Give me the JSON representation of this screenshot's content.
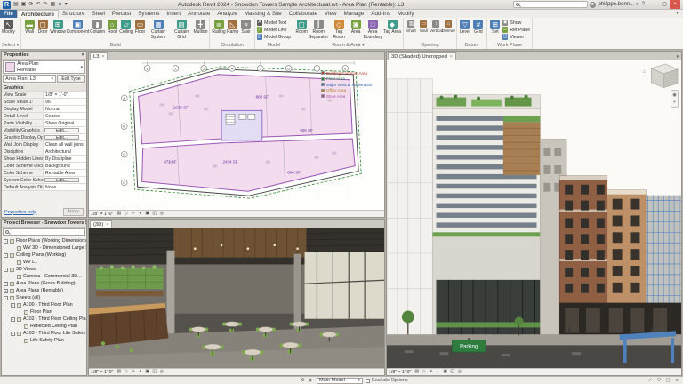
{
  "ui": {
    "close": "×",
    "min": "–",
    "max": "▢",
    "caret": "▾"
  },
  "titlebar": {
    "title": "Autodesk Revit 2024 - Snowdon Towers Sample Architectural.rvt - Area Plan (Rentable): L3",
    "user": "philippe.bonn...",
    "qat": [
      {
        "g": "▤",
        "n": "open-icon"
      },
      {
        "g": "▣",
        "n": "save-icon"
      },
      {
        "g": "⟳",
        "n": "sync-icon"
      },
      {
        "g": "↶",
        "n": "undo-icon"
      },
      {
        "g": "↷",
        "n": "redo-icon"
      },
      {
        "g": "▦",
        "n": "print-icon"
      },
      {
        "g": "◈",
        "n": "measure-icon"
      },
      {
        "g": "▾",
        "n": "customize-qat-icon"
      }
    ]
  },
  "ribbon": {
    "tabs": [
      {
        "label": "File",
        "cls": "file"
      },
      {
        "label": "Architecture",
        "cls": "active"
      },
      {
        "label": "Structure",
        "cls": ""
      },
      {
        "label": "Steel",
        "cls": ""
      },
      {
        "label": "Precast",
        "cls": ""
      },
      {
        "label": "Systems",
        "cls": ""
      },
      {
        "label": "Insert",
        "cls": ""
      },
      {
        "label": "Annotate",
        "cls": ""
      },
      {
        "label": "Analyze",
        "cls": ""
      },
      {
        "label": "Massing & Site",
        "cls": ""
      },
      {
        "label": "Collaborate",
        "cls": ""
      },
      {
        "label": "View",
        "cls": ""
      },
      {
        "label": "Manage",
        "cls": ""
      },
      {
        "label": "Add-Ins",
        "cls": ""
      },
      {
        "label": "Modify",
        "cls": ""
      }
    ],
    "panels": [
      {
        "label": "Select ▾",
        "buttons": [
          {
            "label": "Modify",
            "g": "↖",
            "tone": "dark",
            "name": "modify-button"
          }
        ]
      },
      {
        "label": "Build",
        "buttons": [
          {
            "label": "Wall",
            "g": "▬",
            "tone": "green",
            "name": "wall-button"
          },
          {
            "label": "Door",
            "g": "▢",
            "tone": "brown",
            "name": "door-button"
          },
          {
            "label": "Window",
            "g": "⊞",
            "tone": "teal",
            "name": "window-button"
          },
          {
            "label": "Component",
            "g": "▣",
            "tone": "blue",
            "name": "component-button"
          },
          {
            "label": "Column",
            "g": "▮",
            "tone": "gray",
            "name": "column-button"
          },
          {
            "label": "Roof",
            "g": "⌂",
            "tone": "green",
            "name": "roof-button"
          },
          {
            "label": "Ceiling",
            "g": "▱",
            "tone": "teal",
            "name": "ceiling-button"
          },
          {
            "label": "Floor",
            "g": "▭",
            "tone": "brown",
            "name": "floor-button"
          },
          {
            "label": "Curtain System",
            "g": "▦",
            "tone": "blue",
            "name": "curtain-system-button"
          },
          {
            "label": "Curtain Grid",
            "g": "▤",
            "tone": "teal",
            "name": "curtain-grid-button"
          },
          {
            "label": "Mullion",
            "g": "╋",
            "tone": "gray",
            "name": "mullion-button"
          }
        ]
      },
      {
        "label": "Circulation",
        "buttons": [
          {
            "label": "Railing",
            "g": "≣",
            "tone": "green",
            "name": "railing-button"
          },
          {
            "label": "Ramp",
            "g": "◺",
            "tone": "brown",
            "name": "ramp-button"
          },
          {
            "label": "Stair",
            "g": "≡",
            "tone": "gray",
            "name": "stair-button"
          }
        ]
      },
      {
        "label": "Model",
        "buttons": [
          {
            "label": "Model Text",
            "g": "A",
            "tone": "dark",
            "name": "model-text-button"
          },
          {
            "label": "Model Line",
            "g": "╱",
            "tone": "green",
            "name": "model-line-button"
          },
          {
            "label": "Model Group",
            "g": "◫",
            "tone": "blue",
            "name": "model-group-button"
          }
        ]
      },
      {
        "label": "Room & Area ▾",
        "buttons": [
          {
            "label": "Room",
            "g": "▢",
            "tone": "teal",
            "name": "room-button"
          },
          {
            "label": "Room Separator",
            "g": "┃",
            "tone": "gray",
            "name": "room-separator-button"
          },
          {
            "label": "Tag Room",
            "g": "◇",
            "tone": "orange",
            "name": "tag-room-button"
          },
          {
            "label": "Area",
            "g": "▣",
            "tone": "green",
            "name": "area-button"
          },
          {
            "label": "Area Boundary",
            "g": "□",
            "tone": "purple",
            "name": "area-boundary-button"
          },
          {
            "label": "Tag Area",
            "g": "◆",
            "tone": "teal",
            "name": "tag-area-button"
          }
        ]
      },
      {
        "label": "Opening",
        "buttons": [
          {
            "label": "Shaft",
            "g": "▥",
            "tone": "gray",
            "name": "shaft-opening-button"
          },
          {
            "label": "Wall",
            "g": "▭",
            "tone": "brown",
            "name": "wall-opening-button"
          },
          {
            "label": "Vertical",
            "g": "↕",
            "tone": "gray",
            "name": "vertical-opening-button"
          },
          {
            "label": "Dormer",
            "g": "⌂",
            "tone": "brown",
            "name": "dormer-opening-button"
          }
        ]
      },
      {
        "label": "Datum",
        "buttons": [
          {
            "label": "Level",
            "g": "▽",
            "tone": "blue",
            "name": "level-button"
          },
          {
            "label": "Grid",
            "g": "#",
            "tone": "blue",
            "name": "grid-button"
          }
        ]
      },
      {
        "label": "Work Plane",
        "large": [
          {
            "label": "Set",
            "g": "⊞",
            "tone": "blue",
            "name": "set-work-plane-button"
          }
        ],
        "stack": [
          {
            "label": "Show",
            "g": "◉",
            "tone": "gray",
            "name": "show-work-plane-button"
          },
          {
            "label": "Ref Plane",
            "g": "▱",
            "tone": "green",
            "name": "ref-plane-button"
          },
          {
            "label": "Viewer",
            "g": "◫",
            "tone": "blue",
            "name": "viewer-button"
          }
        ]
      }
    ]
  },
  "properties": {
    "header": "Properties",
    "type_line1": "Area Plan",
    "type_line2": "Rentable",
    "instance_label": "Area Plan: L3",
    "edit_type": "Edit Type",
    "help": "Properties help",
    "apply": "Apply",
    "rows": [
      {
        "kind": "section",
        "label": "Graphics",
        "value": ""
      },
      {
        "kind": "row",
        "label": "View Scale",
        "value": "1/8\" = 1'-0\""
      },
      {
        "kind": "row",
        "label": "Scale Value    1:",
        "value": "96"
      },
      {
        "kind": "row",
        "label": "Display Model",
        "value": "Normal"
      },
      {
        "kind": "row",
        "label": "Detail Level",
        "value": "Coarse"
      },
      {
        "kind": "row",
        "label": "Parts Visibility",
        "value": "Show Original"
      },
      {
        "kind": "button",
        "label": "Visibility/Graphics ...",
        "value": "Edit..."
      },
      {
        "kind": "button",
        "label": "Graphic Display Opti...",
        "value": "Edit..."
      },
      {
        "kind": "row",
        "label": "Wall Join Display",
        "value": "Clean all wall joins"
      },
      {
        "kind": "row",
        "label": "Discipline",
        "value": "Architectural"
      },
      {
        "kind": "row",
        "label": "Show Hidden Lines",
        "value": "By Discipline"
      },
      {
        "kind": "row",
        "label": "Color Scheme Locati...",
        "value": "Background"
      },
      {
        "kind": "row",
        "label": "Color Scheme",
        "value": "Rentable Area"
      },
      {
        "kind": "button",
        "label": "System Color Schem...",
        "value": "Edit..."
      },
      {
        "kind": "row",
        "label": "Default Analysis Dis...",
        "value": "None"
      }
    ]
  },
  "browser": {
    "title": "Project Browser - Snowdon Towers Sample A...",
    "items": [
      {
        "label": "Floor Plans (Working Dimensions)",
        "depth": 0,
        "exp": "-"
      },
      {
        "label": "WV 3D - Dimensioned Large Scale",
        "depth": 1,
        "exp": ""
      },
      {
        "label": "Ceiling Plans (Working)",
        "depth": 0,
        "exp": "-"
      },
      {
        "label": "WV L1",
        "depth": 1,
        "exp": ""
      },
      {
        "label": "3D Views",
        "depth": 0,
        "exp": "-"
      },
      {
        "label": "Camera - Commercial 3D...",
        "depth": 1,
        "exp": ""
      },
      {
        "label": "Area Plans (Gross Building)",
        "depth": 0,
        "exp": "+"
      },
      {
        "label": "Area Plans (Rentable)",
        "depth": 0,
        "exp": "+"
      },
      {
        "label": "Sheets (all)",
        "depth": 0,
        "exp": "-"
      },
      {
        "label": "A100 - Third Floor Plan",
        "depth": 1,
        "exp": "-"
      },
      {
        "label": "Floor Plan",
        "depth": 2,
        "exp": ""
      },
      {
        "label": "A102 - Third Floor Ceiling Plan",
        "depth": 1,
        "exp": "-"
      },
      {
        "label": "Reflected Ceiling Plan",
        "depth": 2,
        "exp": ""
      },
      {
        "label": "A103 - Third Floor Life Safety Plan",
        "depth": 1,
        "exp": "-"
      },
      {
        "label": "Life Safety Plan",
        "depth": 2,
        "exp": ""
      }
    ]
  },
  "planview": {
    "tab": "L3",
    "scale": "1/8\" = 1'-0\"",
    "grids": [
      "1",
      "2",
      "3",
      "4",
      "5",
      "6",
      "7",
      "8"
    ],
    "letters": [
      "A",
      "B",
      "C",
      "D"
    ],
    "tags": [
      "1035 SF",
      "888 SF",
      "2434 SF",
      "926 SF",
      "871 SF",
      "864 SF"
    ],
    "legend": [
      {
        "label": "Building Common Area",
        "style": "color:#c0392b",
        "chip": "background:#c0392b"
      },
      {
        "label": "Floor Area",
        "style": "color:#27863b",
        "chip": "background:#27863b"
      },
      {
        "label": "Major Vertical Penetration",
        "style": "color:#2e5fb0",
        "chip": "background:#2e5fb0"
      },
      {
        "label": "Office Area",
        "style": "color:#b07d2a",
        "chip": "background:#b07d2a"
      },
      {
        "label": "Store Area",
        "style": "color:#a04f9e",
        "chip": "background:#a04f9e"
      }
    ]
  },
  "interior": {
    "tab": "(3D)",
    "scale": "1/8\" = 1'-0\""
  },
  "exterior": {
    "tab": "3D (Shaded) Uncropped",
    "scale": "1/8\" = 1'-0\"",
    "parking": "Parking"
  },
  "viewbar": {
    "icons": [
      {
        "g": "▤",
        "n": "detail-level-icon"
      },
      {
        "g": "◇",
        "n": "visual-style-icon"
      },
      {
        "g": "☀",
        "n": "sun-path-icon"
      },
      {
        "g": "◐",
        "n": "shadows-icon"
      },
      {
        "g": "▣",
        "n": "crop-view-icon"
      },
      {
        "g": "◱",
        "n": "show-crop-icon"
      },
      {
        "g": "◎",
        "n": "reveal-hidden-icon"
      }
    ]
  },
  "statusbar": {
    "design_option_label": "Main Model",
    "exclude_label": "Exclude Options",
    "left_icons": [
      {
        "g": "⟲",
        "n": "worksets-icon"
      },
      {
        "g": "◈",
        "n": "design-options-icon"
      }
    ],
    "right_icons": [
      {
        "g": "✓",
        "n": "editable-only-icon"
      },
      {
        "g": "▽",
        "n": "selection-filter-icon"
      },
      {
        "g": "▢",
        "n": "select-underlay-icon"
      },
      {
        "g": "≡",
        "n": "background-processes-icon"
      }
    ]
  },
  "colors": {
    "accent_blue": "#1f62a8",
    "area_pink": "#f3dcee",
    "area_lavender": "#e2dcf4",
    "boundary_purple": "#9a55b5",
    "revit_green": "#79a03f"
  }
}
